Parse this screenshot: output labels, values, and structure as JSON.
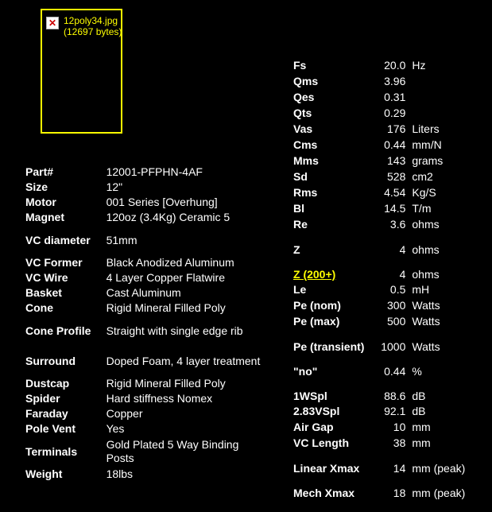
{
  "background_color": "#000000",
  "text_color": "#ffffff",
  "link_color": "#ffff00",
  "broken_image": {
    "icon_name": "broken-image-x-icon",
    "icon_glyph": "✕",
    "filename": "12poly34.jpg",
    "filesize": "(12697 bytes)",
    "border_color": "#ffff00"
  },
  "left_specs": {
    "rows": [
      {
        "label": "Part#",
        "value": "12001-PFPHN-4AF"
      },
      {
        "label": "Size",
        "value": "12\""
      },
      {
        "label": "Motor",
        "value": "001 Series [Overhung]"
      },
      {
        "label": "Magnet",
        "value": "120oz (3.4Kg) Ceramic 5"
      },
      {
        "label": "VC diameter",
        "value": "51mm",
        "tall": true
      },
      {
        "label": "VC Former",
        "value": "Black Anodized Aluminum"
      },
      {
        "label": "VC Wire",
        "value": "4 Layer Copper Flatwire"
      },
      {
        "label": "Basket",
        "value": "Cast Aluminum"
      },
      {
        "label": "Cone",
        "value": "Rigid Mineral Filled Poly"
      },
      {
        "label": "Cone Profile",
        "value": "Straight with single edge rib",
        "tall": true
      },
      {
        "label": "Surround",
        "value": "Doped Foam, 4 layer treatment",
        "tall": true
      },
      {
        "label": "Dustcap",
        "value": "Rigid Mineral Filled Poly"
      },
      {
        "label": "Spider",
        "value": "Hard stiffness Nomex"
      },
      {
        "label": "Faraday",
        "value": "Copper"
      },
      {
        "label": "Pole Vent",
        "value": "Yes"
      },
      {
        "label": "Terminals",
        "value": "Gold Plated 5 Way Binding Posts",
        "tall": true
      },
      {
        "label": "Weight",
        "value": "18lbs"
      }
    ]
  },
  "right_specs": {
    "rows": [
      {
        "label": "Fs",
        "value": "20.0",
        "unit": "Hz"
      },
      {
        "label": "Qms",
        "value": "3.96",
        "unit": ""
      },
      {
        "label": "Qes",
        "value": "0.31",
        "unit": ""
      },
      {
        "label": "Qts",
        "value": "0.29",
        "unit": ""
      },
      {
        "label": "Vas",
        "value": "176",
        "unit": "Liters"
      },
      {
        "label": "Cms",
        "value": "0.44",
        "unit": "mm/N"
      },
      {
        "label": "Mms",
        "value": "143",
        "unit": "grams"
      },
      {
        "label": "Sd",
        "value": "528",
        "unit": "cm2"
      },
      {
        "label": "Rms",
        "value": "4.54",
        "unit": "Kg/S"
      },
      {
        "label": "Bl",
        "value": "14.5",
        "unit": "T/m"
      },
      {
        "label": "Re",
        "value": "3.6",
        "unit": "ohms"
      },
      {
        "label": "Z",
        "value": "4",
        "unit": "ohms",
        "gap": true
      },
      {
        "label": "Z (200+)",
        "value": "4",
        "unit": "ohms",
        "gap": true,
        "link": true
      },
      {
        "label": "Le",
        "value": "0.5",
        "unit": "mH"
      },
      {
        "label": "Pe (nom)",
        "value": "300",
        "unit": "Watts"
      },
      {
        "label": "Pe (max)",
        "value": "500",
        "unit": "Watts"
      },
      {
        "label": "Pe (transient)",
        "value": "1000",
        "unit": "Watts",
        "gap": true
      },
      {
        "label": "\"no\"",
        "value": "0.44",
        "unit": "%",
        "gap": true
      },
      {
        "label": "1WSpl",
        "value": "88.6",
        "unit": "dB",
        "gap": true
      },
      {
        "label": "2.83VSpl",
        "value": "92.1",
        "unit": "dB"
      },
      {
        "label": "Air Gap",
        "value": "10",
        "unit": "mm"
      },
      {
        "label": "VC Length",
        "value": "38",
        "unit": "mm"
      },
      {
        "label": "Linear Xmax",
        "value": "14",
        "unit": "mm (peak)",
        "gap": true
      },
      {
        "label": "Mech Xmax",
        "value": "18",
        "unit": "mm (peak)",
        "gap": true
      }
    ]
  }
}
